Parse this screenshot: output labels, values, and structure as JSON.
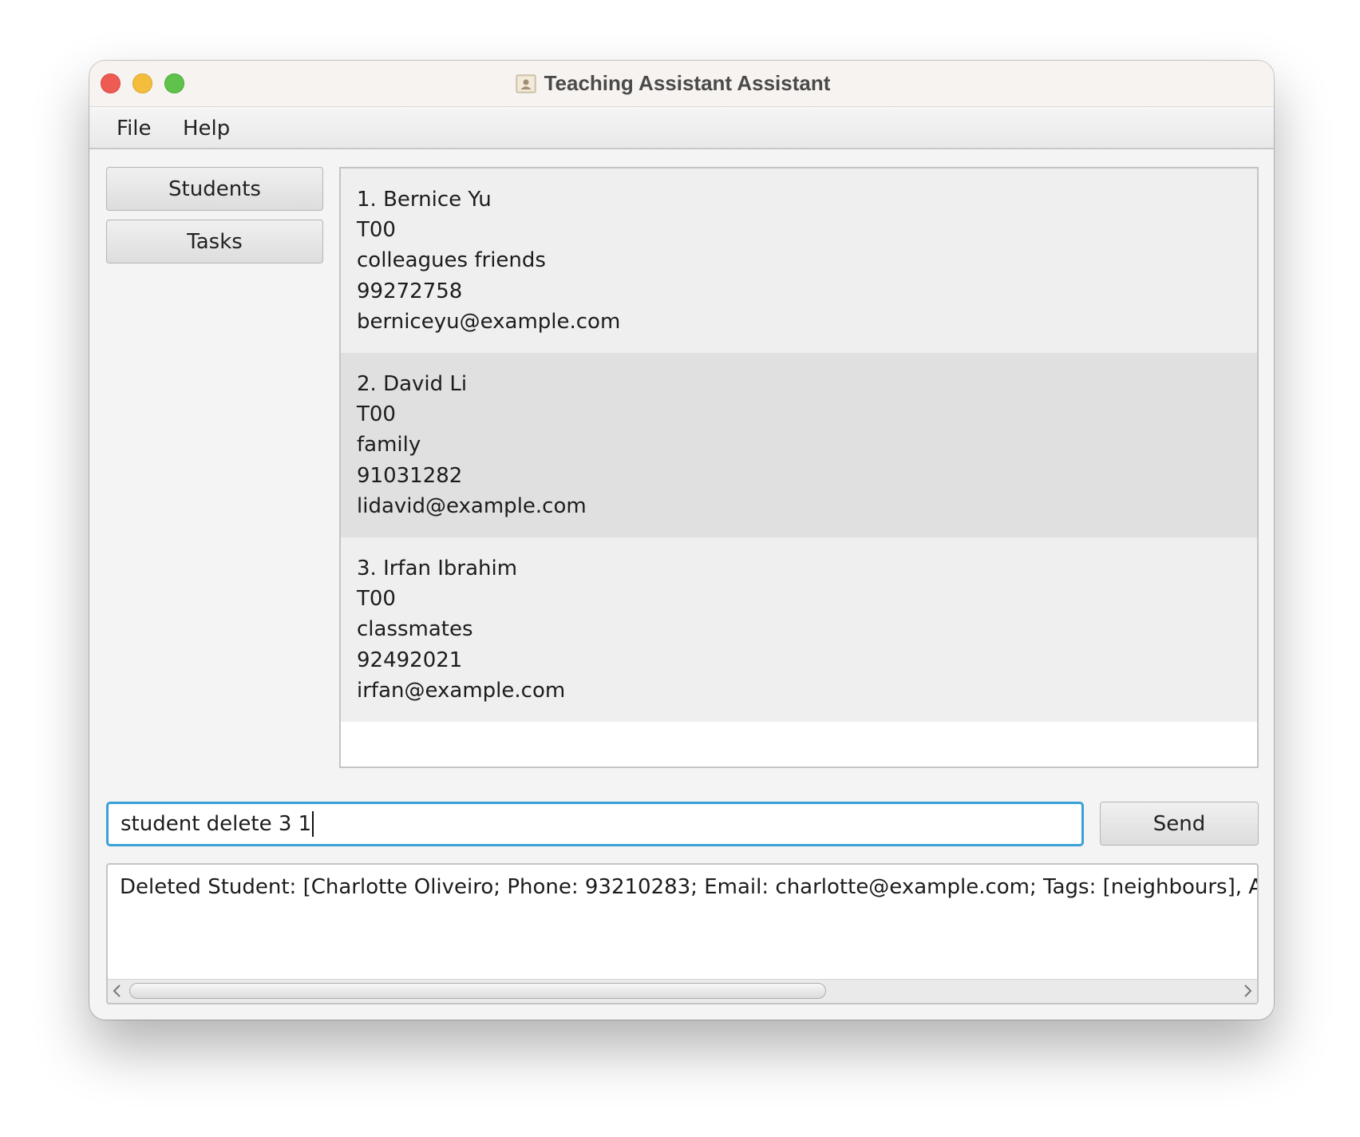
{
  "window": {
    "title": "Teaching Assistant Assistant",
    "app_icon": "contacts-book-icon"
  },
  "menu": {
    "file_label": "File",
    "help_label": "Help"
  },
  "nav": {
    "students_label": "Students",
    "tasks_label": "Tasks"
  },
  "students": [
    {
      "header": "1. Bernice Yu",
      "group": "T00",
      "tags": "colleagues friends",
      "phone": "99272758",
      "email": "berniceyu@example.com"
    },
    {
      "header": "2. David Li",
      "group": "T00",
      "tags": "family",
      "phone": "91031282",
      "email": "lidavid@example.com"
    },
    {
      "header": "3. Irfan Ibrahim",
      "group": "T00",
      "tags": "classmates",
      "phone": "92492021",
      "email": "irfan@example.com"
    }
  ],
  "command": {
    "value": "student delete 3 1",
    "send_label": "Send"
  },
  "result": {
    "text": "Deleted Student: [Charlotte Oliveiro; Phone: 93210283; Email: charlotte@example.com; Tags: [neighbours], Alex Yeo"
  },
  "colors": {
    "close": "#ee5b53",
    "minimize": "#f4be3c",
    "maximize": "#5fc24a",
    "focus_accent": "#39a0d8"
  }
}
